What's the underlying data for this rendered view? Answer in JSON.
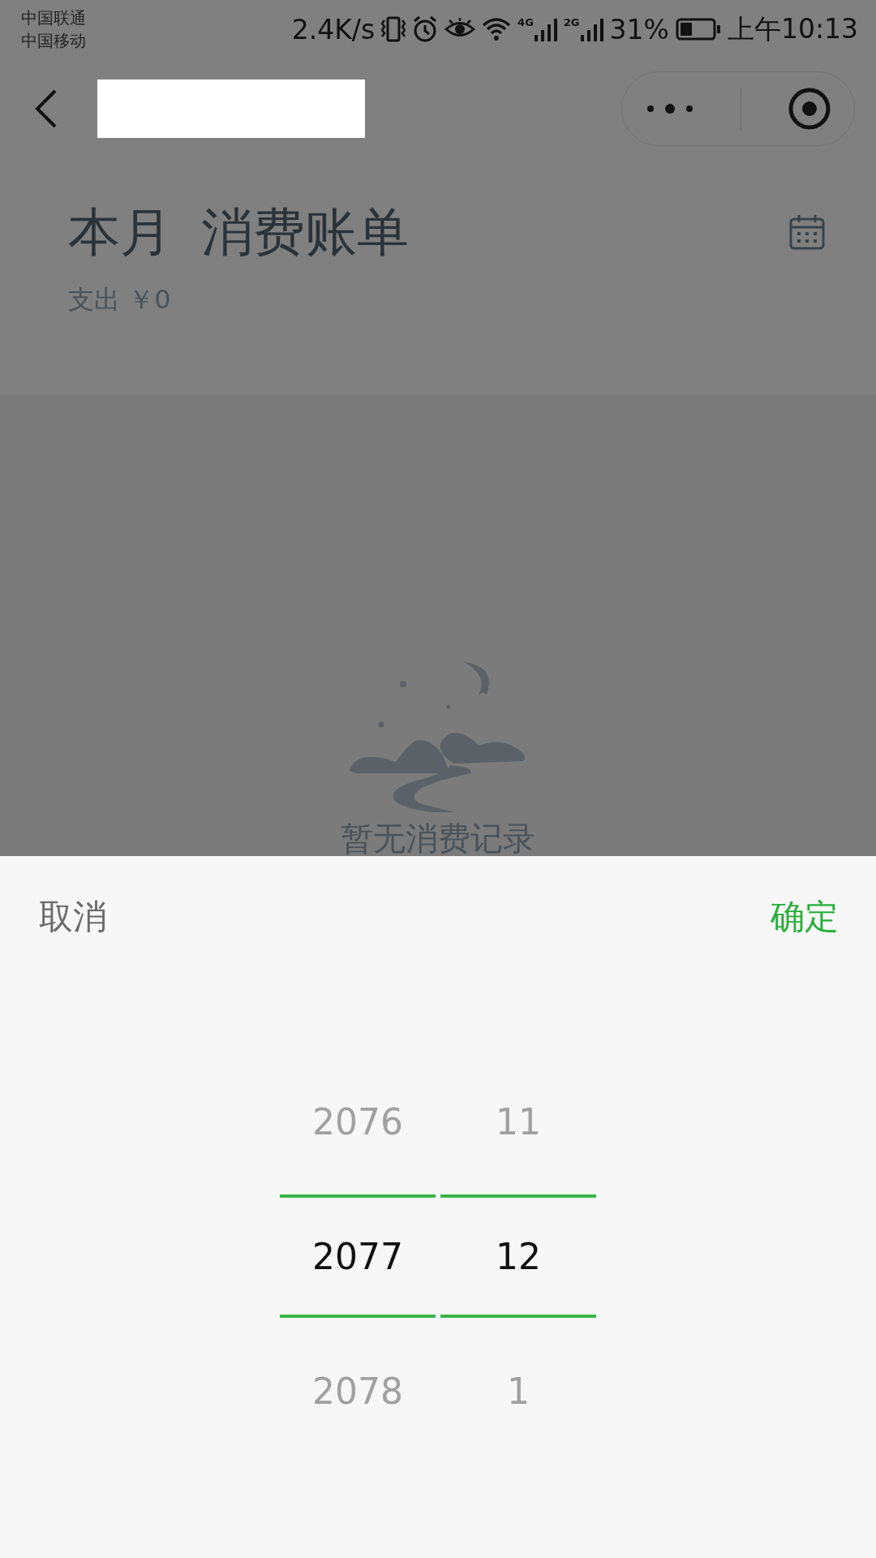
{
  "status_bar": {
    "carriers": [
      "中国联通",
      "中国移动"
    ],
    "speed": "2.4K/s",
    "network_labels": [
      "4G",
      "2G"
    ],
    "battery": "31%",
    "time": "上午10:13"
  },
  "header": {
    "title": "本月",
    "subtitle": "消费账单",
    "summary": "支出 ￥0"
  },
  "empty_state": {
    "message": "暂无消费记录"
  },
  "picker": {
    "cancel": "取消",
    "confirm": "确定",
    "columns": [
      {
        "items": [
          {
            "label": "2076",
            "selected": false
          },
          {
            "label": "2077",
            "selected": true
          },
          {
            "label": "2078",
            "selected": false
          }
        ]
      },
      {
        "items": [
          {
            "label": "11",
            "selected": false
          },
          {
            "label": "12",
            "selected": true
          },
          {
            "label": "1",
            "selected": false
          }
        ]
      }
    ]
  }
}
